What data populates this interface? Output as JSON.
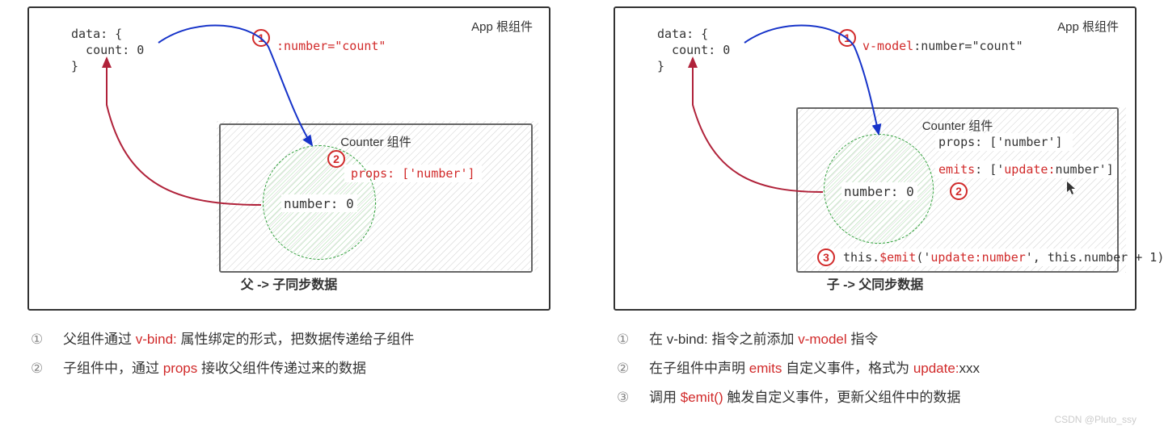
{
  "left": {
    "app_title": "App 根组件",
    "data_l1": "data: {",
    "data_l2": "  count: 0",
    "data_l3": "}",
    "directive": ":number=\"count\"",
    "counter_title": "Counter 组件",
    "props_line": "props: ['number']",
    "number_label": "number: 0",
    "badge1": "1",
    "badge2": "2",
    "caption_strong": "父 -> 子",
    "caption_rest": "同步数据",
    "bullets": [
      {
        "num": "①",
        "pre": "父组件通过 ",
        "hl": "v-bind:",
        "post": " 属性绑定的形式，把数据传递给子组件"
      },
      {
        "num": "②",
        "pre": "子组件中，通过 ",
        "hl": "props",
        "post": " 接收父组件传递过来的数据"
      }
    ]
  },
  "right": {
    "app_title": "App 根组件",
    "data_l1": "data: {",
    "data_l2": "  count: 0",
    "data_l3": "}",
    "directive_pre": "v-model",
    "directive_post": ":number=\"count\"",
    "counter_title": "Counter 组件",
    "props_line": "props: ['number']",
    "emits_pre": "emits",
    "emits_mid": ": ['",
    "emits_hl2": "update:",
    "emits_post": "number']",
    "number_label": "number: 0",
    "emit_call_pre": "this.",
    "emit_call_hl": "$emit",
    "emit_call_mid": "('",
    "emit_call_hl2": "update:number",
    "emit_call_post": "', this.number + 1)",
    "badge1": "1",
    "badge2": "2",
    "badge3": "3",
    "caption_strong": "子 -> 父",
    "caption_rest": "同步数据",
    "bullets": [
      {
        "num": "①",
        "pre": "在 v-bind: 指令之前添加 ",
        "hl": "v-model",
        "post": " 指令"
      },
      {
        "num": "②",
        "pre": "在子组件中声明 ",
        "hl": "emits",
        "post": " 自定义事件，格式为 ",
        "hl2": "update:",
        "post2": "xxx"
      },
      {
        "num": "③",
        "pre": "调用 ",
        "hl": "$emit()",
        "post": " 触发自定义事件，更新父组件中的数据"
      }
    ]
  },
  "watermark": "CSDN @Pluto_ssy"
}
